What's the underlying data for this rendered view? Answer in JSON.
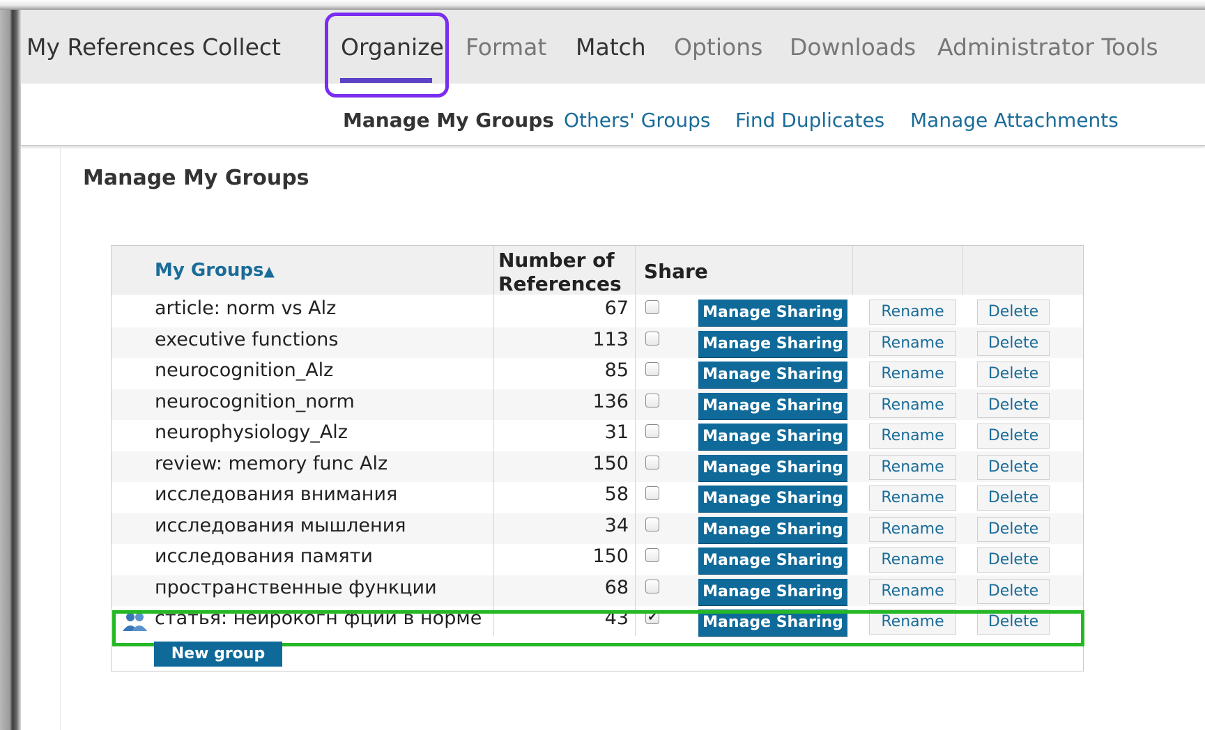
{
  "nav": {
    "items": [
      {
        "label": "My References"
      },
      {
        "label": "Collect"
      },
      {
        "label": "Organize"
      },
      {
        "label": "Format"
      },
      {
        "label": "Match"
      },
      {
        "label": "Options"
      },
      {
        "label": "Downloads"
      },
      {
        "label": "Administrator Tools"
      }
    ],
    "active": "Organize"
  },
  "subnav": {
    "items": [
      {
        "label": "Manage My Groups"
      },
      {
        "label": "Others' Groups"
      },
      {
        "label": "Find Duplicates"
      },
      {
        "label": "Manage Attachments"
      }
    ],
    "active": "Manage My Groups"
  },
  "page": {
    "title": "Manage My Groups"
  },
  "table": {
    "header": {
      "groups": "My Groups",
      "sort_icon": "sort-up-icon",
      "number_line1": "Number of",
      "number_line2": "References",
      "share": "Share"
    },
    "buttons": {
      "manage": "Manage Sharing",
      "rename": "Rename",
      "delete": "Delete"
    },
    "rows": [
      {
        "name": "article: norm vs Alz",
        "count": "67",
        "shared": false
      },
      {
        "name": "executive functions",
        "count": "113",
        "shared": false
      },
      {
        "name": "neurocognition_Alz",
        "count": "85",
        "shared": false
      },
      {
        "name": "neurocognition_norm",
        "count": "136",
        "shared": false
      },
      {
        "name": "neurophysiology_Alz",
        "count": "31",
        "shared": false
      },
      {
        "name": "review: memory func Alz",
        "count": "150",
        "shared": false
      },
      {
        "name": "исследования внимания",
        "count": "58",
        "shared": false
      },
      {
        "name": "исследования мышления",
        "count": "34",
        "shared": false
      },
      {
        "name": "исследования памяти",
        "count": "150",
        "shared": false
      },
      {
        "name": "пространственные функции",
        "count": "68",
        "shared": false
      },
      {
        "name": "статья: нейрокогн фции в норме",
        "count": "43",
        "shared": true,
        "icon": "shared-group-icon"
      }
    ],
    "new_group": "New group"
  },
  "colors": {
    "link": "#1a6c99",
    "button": "#0f6a9a",
    "nav_underline": "#5b42c6",
    "nav_highlight": "#7a2cf0",
    "row_highlight": "#25b825"
  }
}
